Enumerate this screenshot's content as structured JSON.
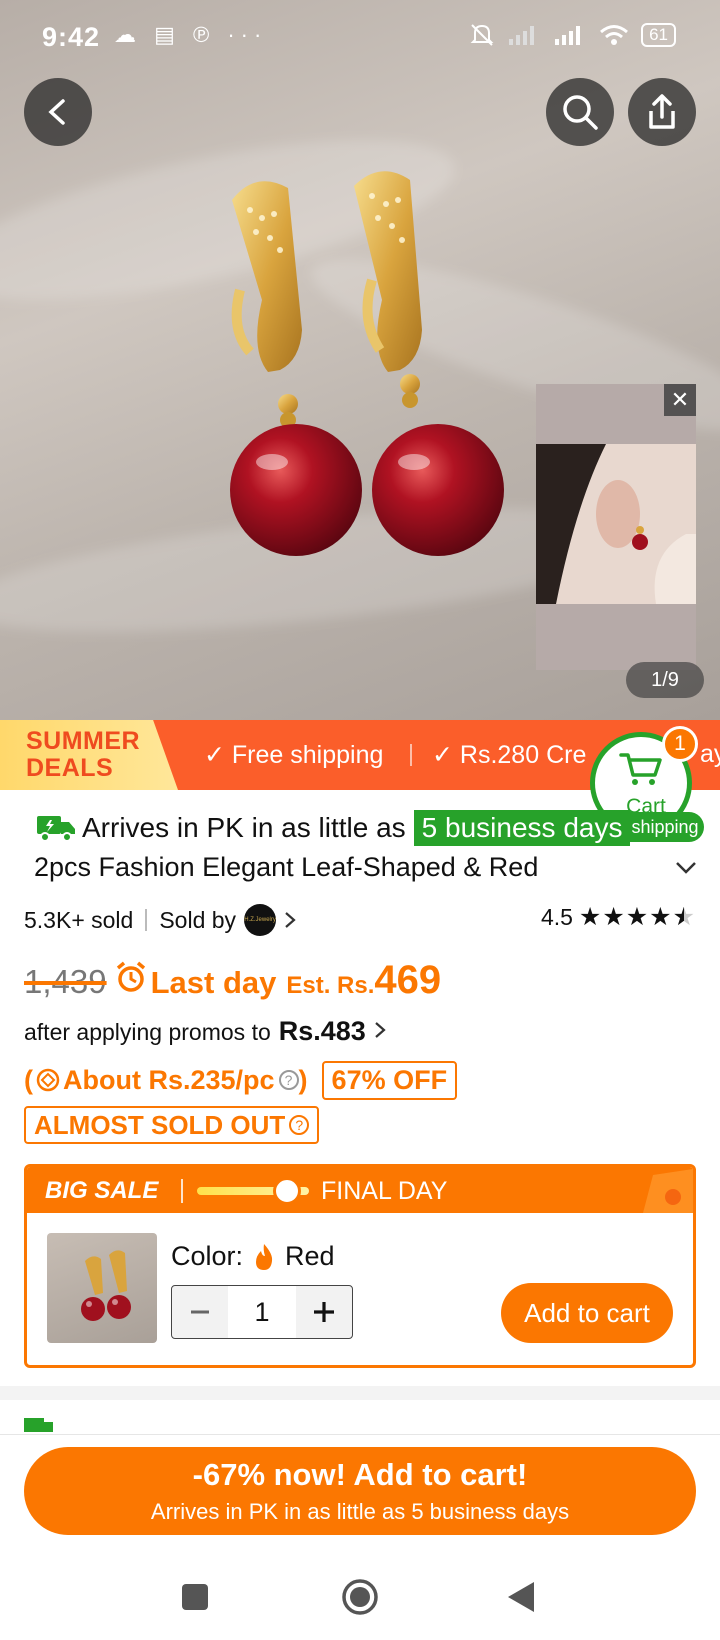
{
  "status_bar": {
    "time": "9:42",
    "left_icons": "☁ ▤ ℗ ···",
    "battery": "61"
  },
  "gallery": {
    "counter": "1/9",
    "close_symbol": "✕"
  },
  "promo_strip": {
    "summer_line1": "SUMMER",
    "summer_line2": "DEALS",
    "item1": "Free shipping",
    "item2": "Rs.280 Cre",
    "item3": "ay"
  },
  "cart": {
    "label": "Cart",
    "count": "1",
    "free_shipping": "Free shipping"
  },
  "delivery": {
    "text": "Arrives in PK in as little as",
    "days": "5 business days"
  },
  "product": {
    "title": "2pcs Fashion Elegant Leaf-Shaped & Red",
    "sold": "5.3K+ sold",
    "sold_by": "Sold by",
    "seller_logo_text": "H.Z.Jewelry",
    "rating": "4.5",
    "rating_value": 4.5
  },
  "price": {
    "old": "1,439",
    "last_day": "Last day",
    "est_label": "Est. Rs.",
    "est_value": "469",
    "promo_text": "after applying promos to",
    "promo_price": "Rs.483",
    "about": "About Rs.235/pc",
    "off": "67% OFF",
    "almost_sold_out": "ALMOST SOLD OUT"
  },
  "sale_card": {
    "big_sale": "BIG SALE",
    "final_day": "FINAL DAY",
    "color_label": "Color:",
    "color_value": "Red",
    "quantity": "1",
    "add_to_cart": "Add to cart"
  },
  "bottom_cta": {
    "main": "-67% now! Add to cart!",
    "sub": "Arrives in PK in as little as 5 business days"
  },
  "colors": {
    "accent": "#fb7701",
    "promo_red": "#fb5e2a",
    "green": "#27a22a"
  }
}
